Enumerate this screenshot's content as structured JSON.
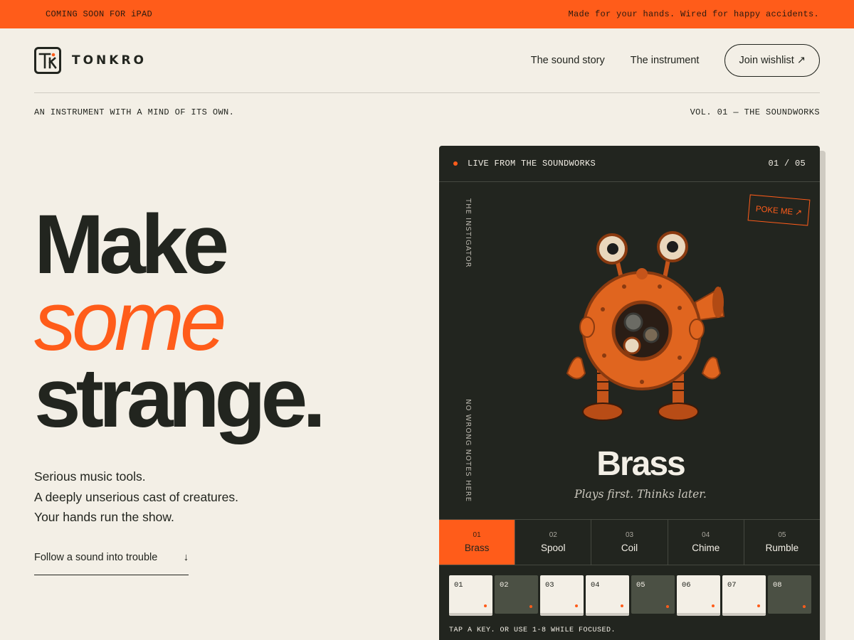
{
  "topbar": {
    "left": "COMING SOON FOR iPAD",
    "right": "Made for your hands. Wired for happy accidents."
  },
  "brand": {
    "name": "TONKRO",
    "logo_icon": "tk-monogram-logo"
  },
  "nav": {
    "items": [
      "The sound story",
      "The instrument"
    ],
    "cta": "Join wishlist ↗"
  },
  "tagline": {
    "left": "AN INSTRUMENT WITH A MIND OF ITS OWN.",
    "right": "VOL. 01 — THE SOUNDWORKS"
  },
  "hero": {
    "line1": "Make",
    "line2": "some",
    "line3": "strange.",
    "sub": [
      "Serious music tools.",
      "A deeply unserious cast of creatures.",
      "Your hands run the show."
    ],
    "cta": "Follow a sound into trouble",
    "cta_icon": "↓"
  },
  "panel": {
    "live": "LIVE FROM THE SOUNDWORKS",
    "counter": "01 / 05",
    "vertical_top": "THE INSTIGATOR",
    "vertical_bottom": "NO WRONG NOTES HERE",
    "poke": "POKE ME ↗",
    "creature_name": "Brass",
    "creature_tagline": "Plays first. Thinks later.",
    "tabs": [
      {
        "num": "01",
        "label": "Brass"
      },
      {
        "num": "02",
        "label": "Spool"
      },
      {
        "num": "03",
        "label": "Coil"
      },
      {
        "num": "04",
        "label": "Chime"
      },
      {
        "num": "05",
        "label": "Rumble"
      }
    ],
    "keys": [
      "01",
      "02",
      "03",
      "04",
      "05",
      "06",
      "07",
      "08"
    ],
    "key_hint": "TAP A KEY. OR USE 1-8 WHILE FOCUSED."
  },
  "colors": {
    "accent": "#ff5c1a",
    "ink": "#22251f",
    "paper": "#f3efe6",
    "panel": "#22251f"
  }
}
